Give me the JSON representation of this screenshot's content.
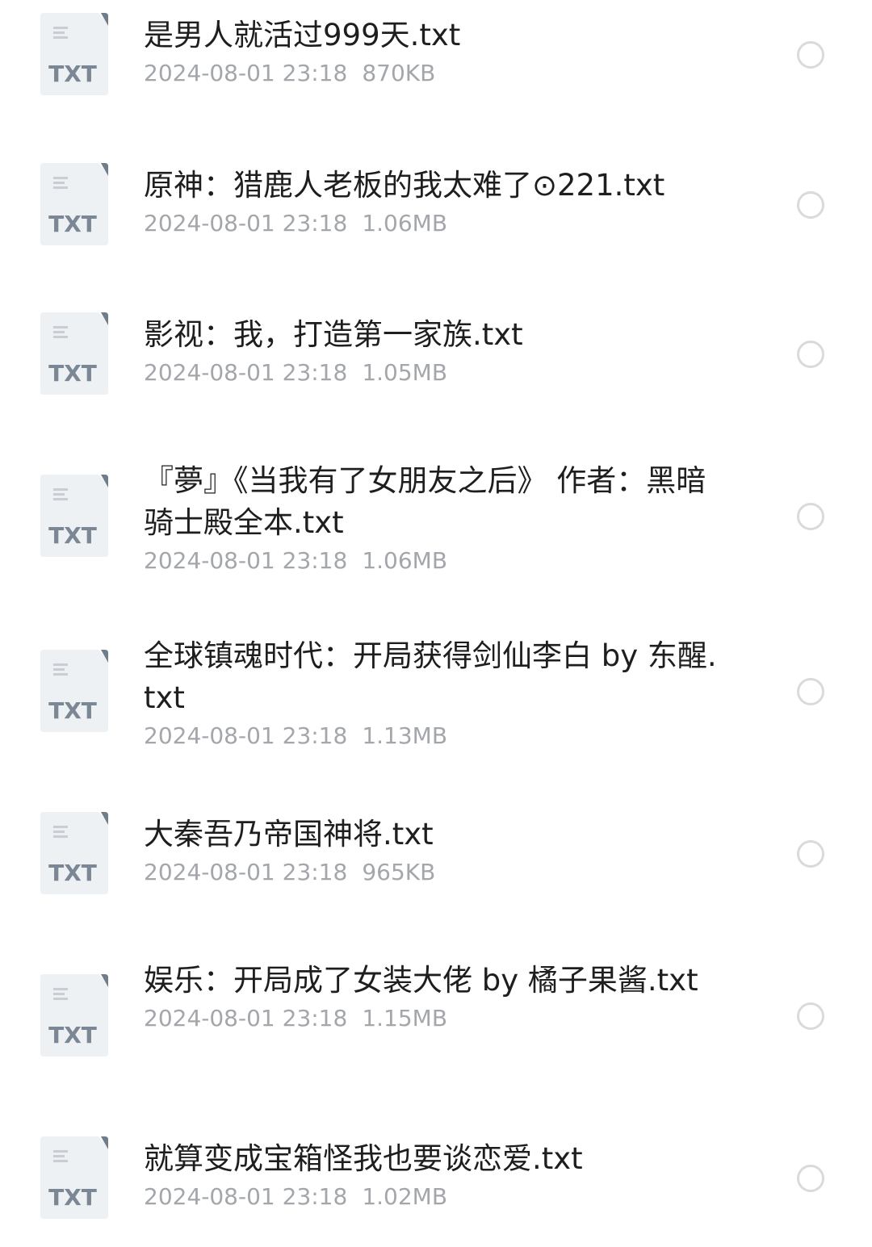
{
  "colors": {
    "title_text": "#1e1e1e",
    "meta_text": "#a3a6ab",
    "icon_body": "#eef1f4",
    "icon_label": "#7b8794",
    "radio_border": "#d9dadc"
  },
  "icon": {
    "type": "txt-file-icon",
    "label": "TXT"
  },
  "files": [
    {
      "name": "是男人就活过999天.txt",
      "date": "2024-08-01 23:18",
      "size": "870KB",
      "selected": false
    },
    {
      "name": "原神：猎鹿人老板的我太难了⊙221.txt",
      "date": "2024-08-01 23:18",
      "size": "1.06MB",
      "selected": false
    },
    {
      "name": "影视：我，打造第一家族.txt",
      "date": "2024-08-01 23:18",
      "size": "1.05MB",
      "selected": false
    },
    {
      "name": "『夢』《当我有了女朋友之后》 作者：黑暗骑士殿全本.txt",
      "date": "2024-08-01 23:18",
      "size": "1.06MB",
      "selected": false
    },
    {
      "name": "全球镇魂时代：开局获得剑仙李白 by 东醒.txt",
      "date": "2024-08-01 23:18",
      "size": "1.13MB",
      "selected": false
    },
    {
      "name": "大秦吾乃帝国神将.txt",
      "date": "2024-08-01 23:18",
      "size": "965KB",
      "selected": false
    },
    {
      "name": "娱乐：开局成了女装大佬 by 橘子果酱.txt",
      "date": "2024-08-01 23:18",
      "size": "1.15MB",
      "selected": false
    },
    {
      "name": "就算变成宝箱怪我也要谈恋爱.txt",
      "date": "2024-08-01 23:18",
      "size": "1.02MB",
      "selected": false
    }
  ]
}
